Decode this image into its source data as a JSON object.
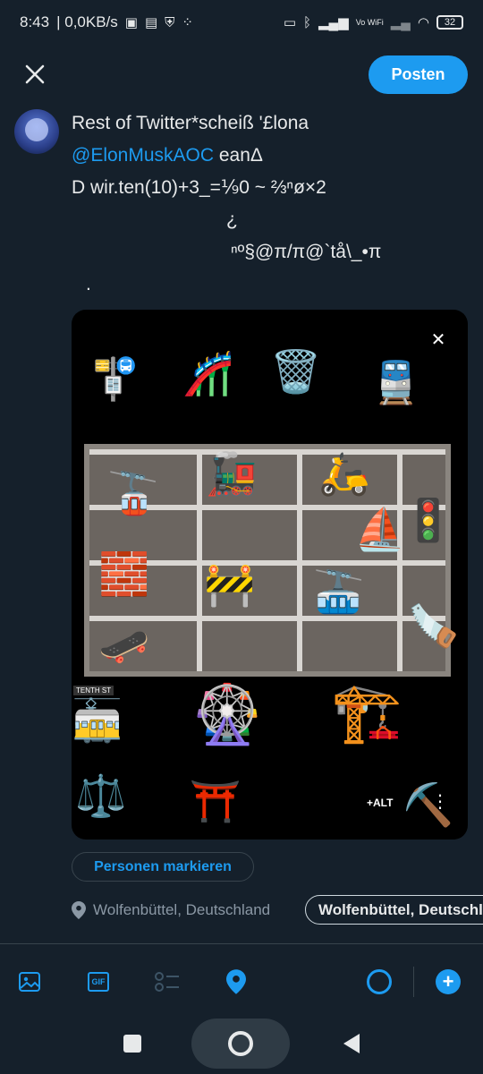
{
  "status_bar": {
    "time": "8:43",
    "network_speed": "| 0,0KB/s",
    "volte": "Vo WiFi",
    "battery": "32"
  },
  "header": {
    "post_label": "Posten"
  },
  "composer": {
    "line1": "Rest of Twitter*scheiß '£lona",
    "mention": "@ElonMuskAOC",
    "line2_rest": " eanΔ",
    "line3": "D wir.ten(10)+3_=⅑0 ~ ⅔ⁿø×2",
    "line4": "¿",
    "line5": "ⁿº§@π/π@`tå\\_•π",
    "line6": "."
  },
  "media": {
    "alt_label": "+ALT",
    "street_sign": "TENTH ST",
    "emoji_grid": [
      "🚏",
      "🎢",
      "🗑️",
      "🚆",
      "🚡",
      "🚂",
      "🛵",
      "⛵",
      "🚦",
      "🧱",
      "🚧",
      "🚠",
      "🪚",
      "🛹",
      "🚋",
      "🎡",
      "🏗️",
      "⚖️",
      "⛩️",
      "⛏️"
    ]
  },
  "tag_people_label": "Personen markieren",
  "location": {
    "text": "Wolfenbüttel, Deutschland",
    "chip_label": "Wolfenbüttel, Deutschland"
  },
  "colors": {
    "background": "#15202b",
    "accent": "#1d9bf0",
    "text": "#e7e9ea",
    "muted": "#8b98a5"
  },
  "toolbar": {
    "icons": [
      "image-icon",
      "gif-icon",
      "poll-icon",
      "location-icon",
      "char-count-ring",
      "add-thread-icon"
    ]
  }
}
